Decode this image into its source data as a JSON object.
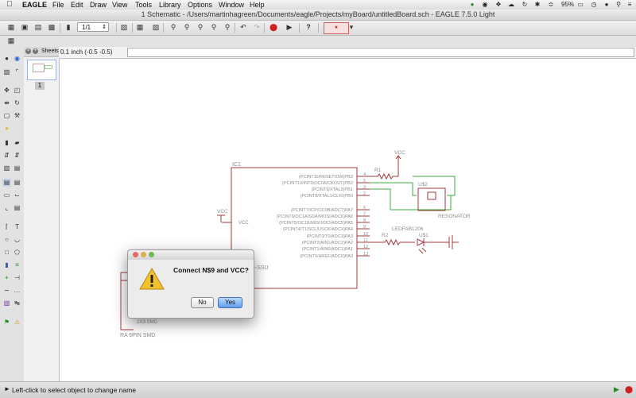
{
  "menubar": {
    "apple_icon": "apple-icon",
    "app": "EAGLE",
    "items": [
      "File",
      "Edit",
      "Draw",
      "View",
      "Tools",
      "Library",
      "Options",
      "Window",
      "Help"
    ],
    "battery": "95%"
  },
  "window": {
    "title": "1 Schematic - /Users/martinhagreen/Documents/eagle/Projects/myBoard/untitledBoard.sch - EAGLE 7.5.0 Light"
  },
  "toolbar": {
    "page_value": "1/1"
  },
  "sheets": {
    "label": "Sheets",
    "page_number": "1"
  },
  "coordinates": "0.1 inch (-0.5 -0.5)",
  "schematic": {
    "ic_name": "IC1",
    "ic_value_suffix": "4-SSU",
    "pins_right": [
      {
        "label": "(PCINT11/RESET/DW)PB3",
        "num": "4"
      },
      {
        "label": "(PCINT10/INT0/OC0A/CKOUT)PB2",
        "num": "5"
      },
      {
        "label": "(PCINT9/XTAL2)PB1",
        "num": "3"
      },
      {
        "label": "(PCINT8/XTAL1/CLKI)PB0",
        "num": "2"
      },
      {
        "label": "(PCINT7/ICP/OC0B/ADC7)PA7",
        "num": "6"
      },
      {
        "label": "(PCINT6/OC1A/SDA/MOSI/ADC6)PA6",
        "num": "7"
      },
      {
        "label": "(PCINT5/OC1B/MISO/DO/ADC5)PA5",
        "num": "8"
      },
      {
        "label": "(PCINT4/T1/SCL/USCK/ADC4)PA4",
        "num": "9"
      },
      {
        "label": "(PCINT3/T0/ADC3)PA3",
        "num": "10"
      },
      {
        "label": "(PCINT2/AIN1/ADC2)PA2",
        "num": "11"
      },
      {
        "label": "(PCINT1/AIN0/ADC1)PA1",
        "num": "12"
      },
      {
        "label": "(PCINT0/AREF/ADC0)PA0",
        "num": "13"
      }
    ],
    "vcc_pin": "VCC",
    "vcc_supply_left": "VCC",
    "vcc_supply_top": "VCC",
    "r1": "R1",
    "r2": "R2",
    "u_resonator": "U$2",
    "resonator_label": "RESONATOR",
    "led_value": "LEDFAB1206",
    "led_name": "U$1",
    "partial_label": "RA 6PIN SMD",
    "partial_value": "2X3-SMD"
  },
  "dialog": {
    "message": "Connect N$9 and VCC?",
    "no_label": "No",
    "yes_label": "Yes"
  },
  "statusbar": {
    "message": "Left-click to select object to change name"
  },
  "colors": {
    "wire": "#3cae3c",
    "component": "#a0383c",
    "text": "#8c8c8c",
    "accent": "#5e9cee"
  }
}
